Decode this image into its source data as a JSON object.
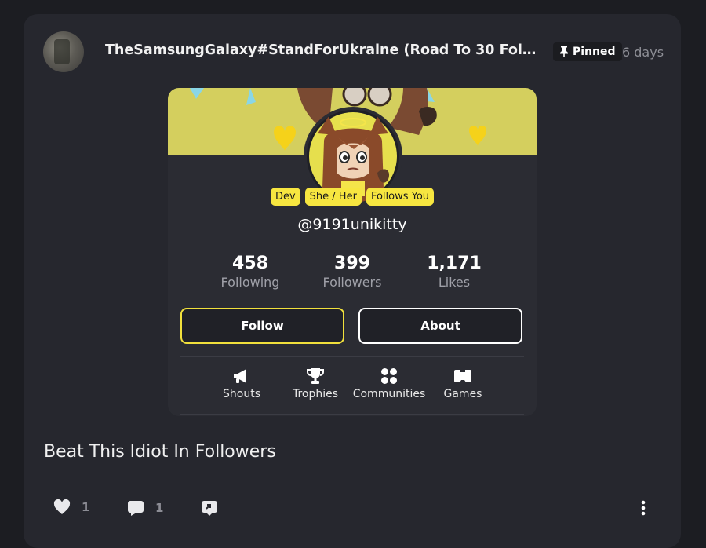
{
  "post": {
    "author": "TheSamsungGalaxy#StandForUkraine (Road To 30 Follow...",
    "pinned_label": "Pinned",
    "time": "6 days",
    "text": "Beat This Idiot In Followers"
  },
  "profile": {
    "tags": [
      "Dev",
      "She / Her",
      "Follows You"
    ],
    "handle": "@9191unikitty",
    "stats": {
      "following": {
        "value": "458",
        "label": "Following"
      },
      "followers": {
        "value": "399",
        "label": "Followers"
      },
      "likes": {
        "value": "1,171",
        "label": "Likes"
      }
    },
    "buttons": {
      "follow": "Follow",
      "about": "About"
    },
    "nav": {
      "shouts": "Shouts",
      "trophies": "Trophies",
      "communities": "Communities",
      "games": "Games"
    }
  },
  "actions": {
    "likes": "1",
    "comments": "1"
  },
  "colors": {
    "accent_yellow": "#f7e640",
    "card_bg": "#26272e",
    "page_bg": "#1c1d22"
  }
}
